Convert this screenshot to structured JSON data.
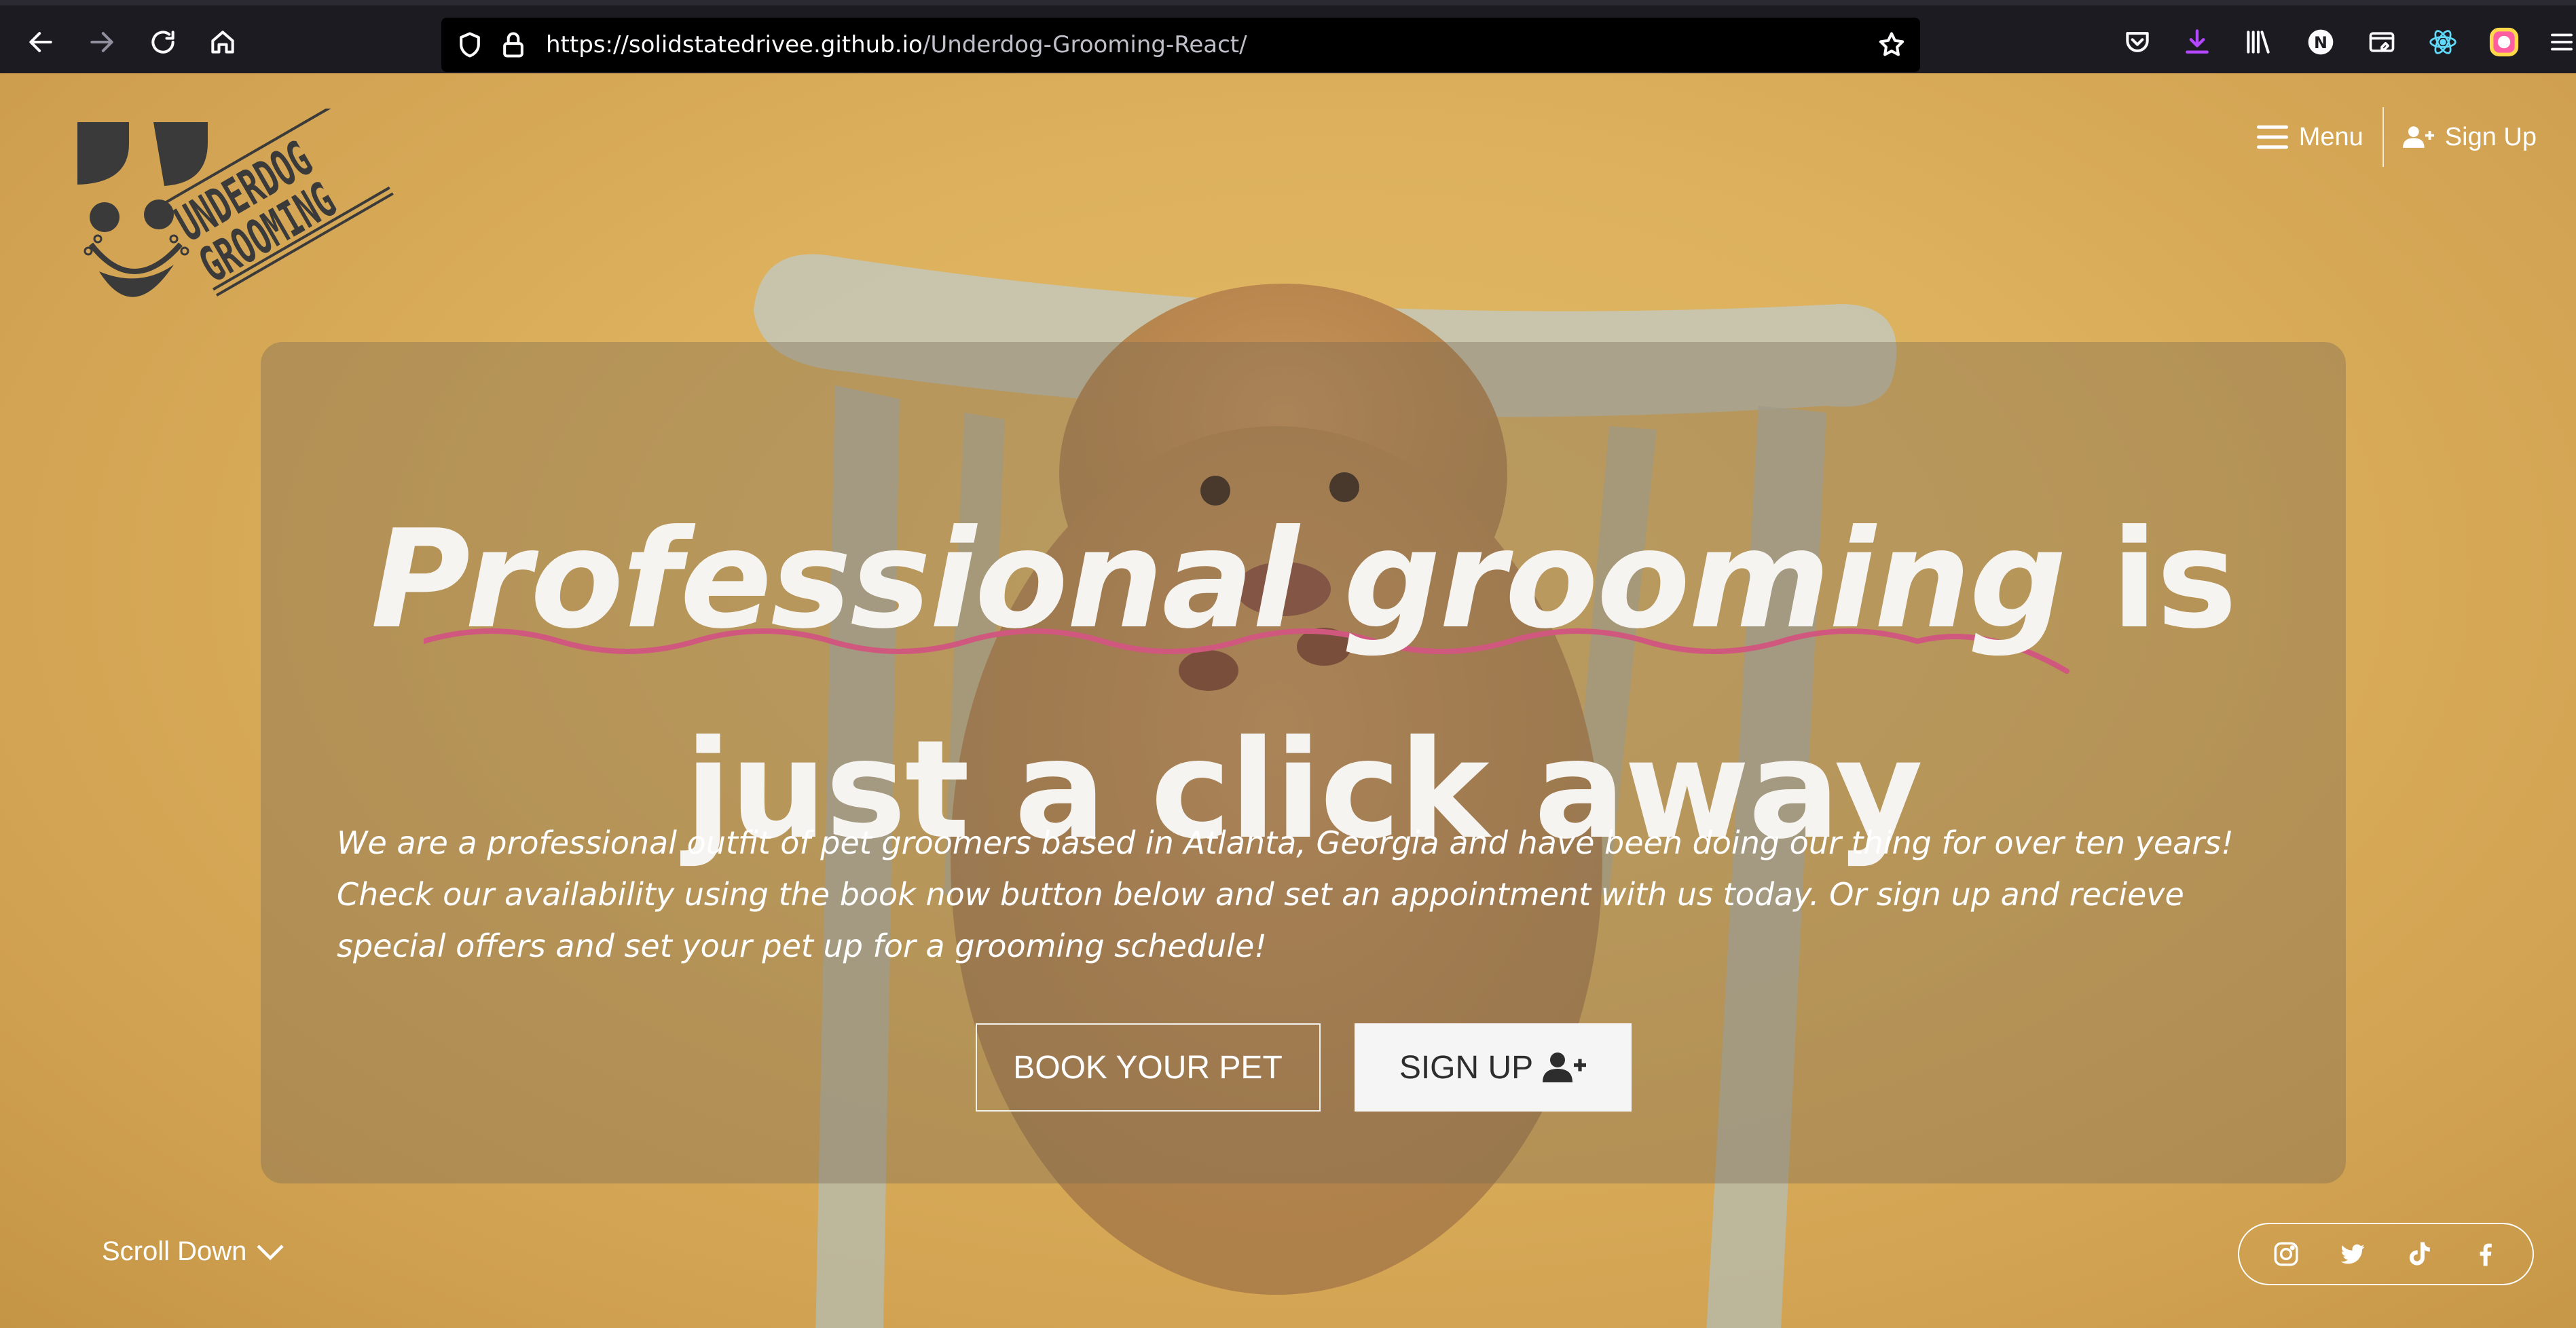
{
  "browser": {
    "url_host": "https://solidstatedrivee.github.io",
    "url_path": "/Underdog-Grooming-React/",
    "extension_n_label": "N"
  },
  "site": {
    "logo_text_top": "UNDERDOG",
    "logo_text_bottom": "GROOMING"
  },
  "nav": {
    "menu_label": "Menu",
    "signup_label": "Sign Up"
  },
  "hero": {
    "headline_em1": "Professional",
    "headline_em2": "grooming",
    "headline_rest1": "is",
    "headline_line2": "just a click away",
    "description": "We are a professional outfit of pet groomers based in Atlanta, Georgia and have been doing our thing for over ten years! Check our availability using the book now button below and set an appointment with us today. Or sign up and recieve special offers and set your pet up for a grooming schedule!",
    "book_button": "BOOK YOUR PET",
    "signup_button": "SIGN UP"
  },
  "footer": {
    "scroll_label": "Scroll Down"
  },
  "social": [
    "instagram-icon",
    "twitter-icon",
    "tiktok-icon",
    "facebook-icon"
  ],
  "colors": {
    "accent_squiggle": "#d0587e",
    "background": "#ddb15d",
    "overlay": "#786955",
    "text": "#ffffff"
  }
}
